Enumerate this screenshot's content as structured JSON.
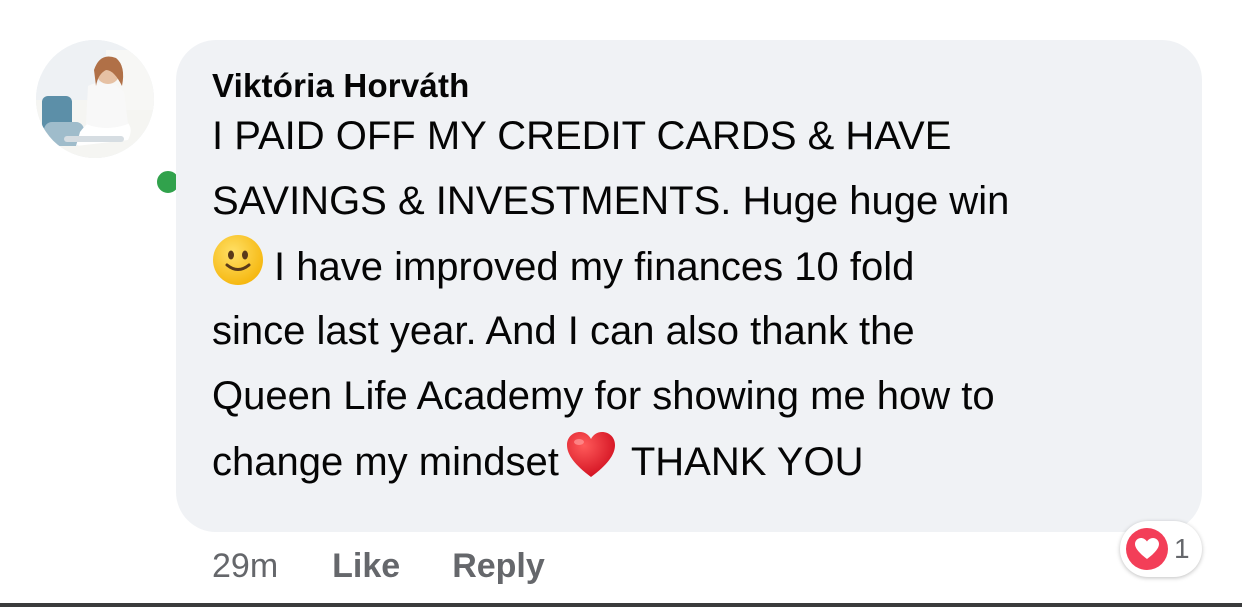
{
  "comment": {
    "author": "Viktória Horváth",
    "lines": [
      {
        "pre_emoji": "",
        "text": "I PAID OFF MY CREDIT CARDS & HAVE"
      },
      {
        "pre_emoji": "",
        "text": "SAVINGS & INVESTMENTS. Huge huge win"
      },
      {
        "pre_emoji": "slightly-smiling-face-emoji",
        "text": "I have improved my finances 10 fold"
      },
      {
        "pre_emoji": "",
        "text": "since last year. And I can also thank the"
      },
      {
        "pre_emoji": "",
        "text": "Queen Life Academy for showing me how to"
      },
      {
        "pre_emoji": "",
        "text": "change my mindset",
        "post_emoji": "red-heart-emoji",
        "after": "THANK YOU"
      }
    ],
    "online": true
  },
  "actions": {
    "time": "29m",
    "like_label": "Like",
    "reply_label": "Reply"
  },
  "reactions": {
    "icon": "love-heart-icon",
    "count": "1"
  },
  "colors": {
    "bubble": "#f0f2f5",
    "online": "#31a24c",
    "love": "#f33e58",
    "secondary_text": "#65676b"
  }
}
